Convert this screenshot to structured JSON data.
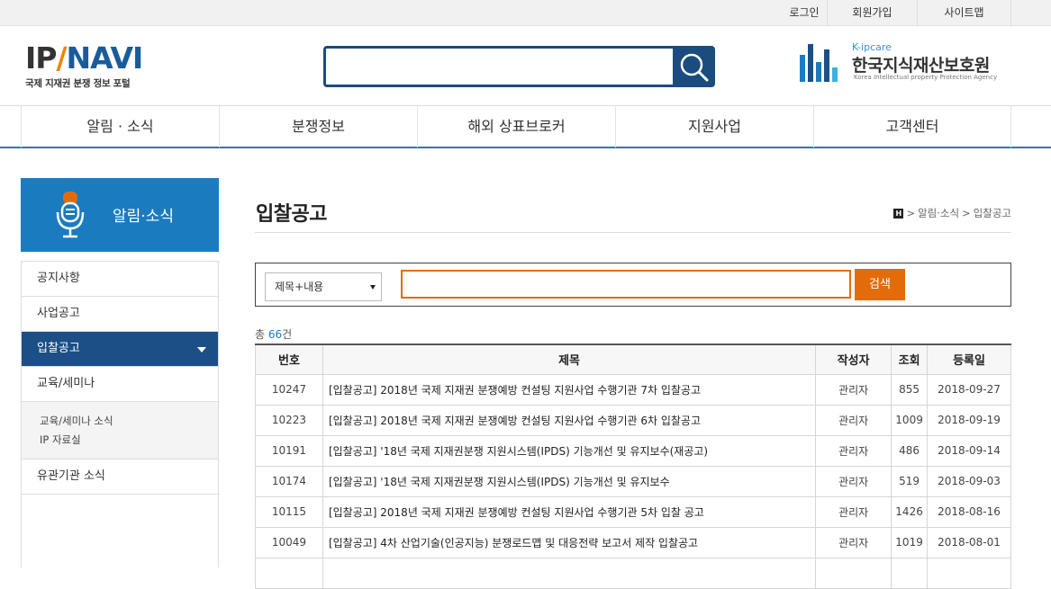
{
  "top_links": [
    "로그인",
    "회원가입",
    "사이트맵"
  ],
  "logo": {
    "ip": "IP",
    "slash": "/",
    "navi": "NAVI",
    "tagline": "국제 지재권 분쟁 정보 포털"
  },
  "search": {
    "placeholder": ""
  },
  "agency": {
    "en_small": "K-ipcare",
    "name_ko": "한국지식재산보호원",
    "name_en": "Korea Intellectual property Protection Agency"
  },
  "gnb": [
    "알림 · 소식",
    "분쟁정보",
    "해외 상표브로커",
    "지원사업",
    "고객센터"
  ],
  "sidebar": {
    "header": "알림·소식",
    "items": [
      "공지사항",
      "사업공고",
      "입찰공고",
      "교육/세미나"
    ],
    "sub_items": [
      "교육/세미나 소식",
      "IP 자료실"
    ],
    "last_item": "유관기관 소식"
  },
  "page": {
    "title": "입찰공고",
    "breadcrumb": [
      "H",
      "알림·소식",
      "입찰공고"
    ],
    "separator": ">"
  },
  "board_search": {
    "select_value": "제목+내용",
    "button": "검색"
  },
  "count": {
    "prefix": "총 ",
    "value": "66",
    "suffix": "건"
  },
  "table": {
    "headers": [
      "번호",
      "제목",
      "작성자",
      "조회",
      "등록일"
    ],
    "rows": [
      [
        "10247",
        "[입찰공고] 2018년 국제 지재권 분쟁예방 컨설팅 지원사업 수행기관 7차 입찰공고",
        "관리자",
        "855",
        "2018-09-27"
      ],
      [
        "10223",
        "[입찰공고] 2018년 국제 지재권 분쟁예방 컨설팅 지원사업 수행기관 6차 입찰공고",
        "관리자",
        "1009",
        "2018-09-19"
      ],
      [
        "10191",
        "[입찰공고] '18년 국제 지재권분쟁 지원시스템(IPDS) 기능개선 및 유지보수(재공고)",
        "관리자",
        "486",
        "2018-09-14"
      ],
      [
        "10174",
        "[입찰공고] '18년 국제 지재권분쟁 지원시스템(IPDS) 기능개선 및 유지보수",
        "관리자",
        "519",
        "2018-09-03"
      ],
      [
        "10115",
        "[입찰공고] 2018년 국제 지재권 분쟁예방 컨설팅 지원사업 수행기관 5차 입찰 공고",
        "관리자",
        "1426",
        "2018-08-16"
      ],
      [
        "10049",
        "[입찰공고] 4차 산업기술(인공지능) 분쟁로드맵 및 대응전략 보고서 제작 입찰공고",
        "관리자",
        "1019",
        "2018-08-01"
      ],
      [
        "",
        "",
        "",
        "",
        ""
      ]
    ]
  },
  "colors": {
    "navy": "#1a4c7e",
    "blue": "#1b7bbf",
    "orange": "#e36c0a",
    "active": "#1b4f86"
  }
}
